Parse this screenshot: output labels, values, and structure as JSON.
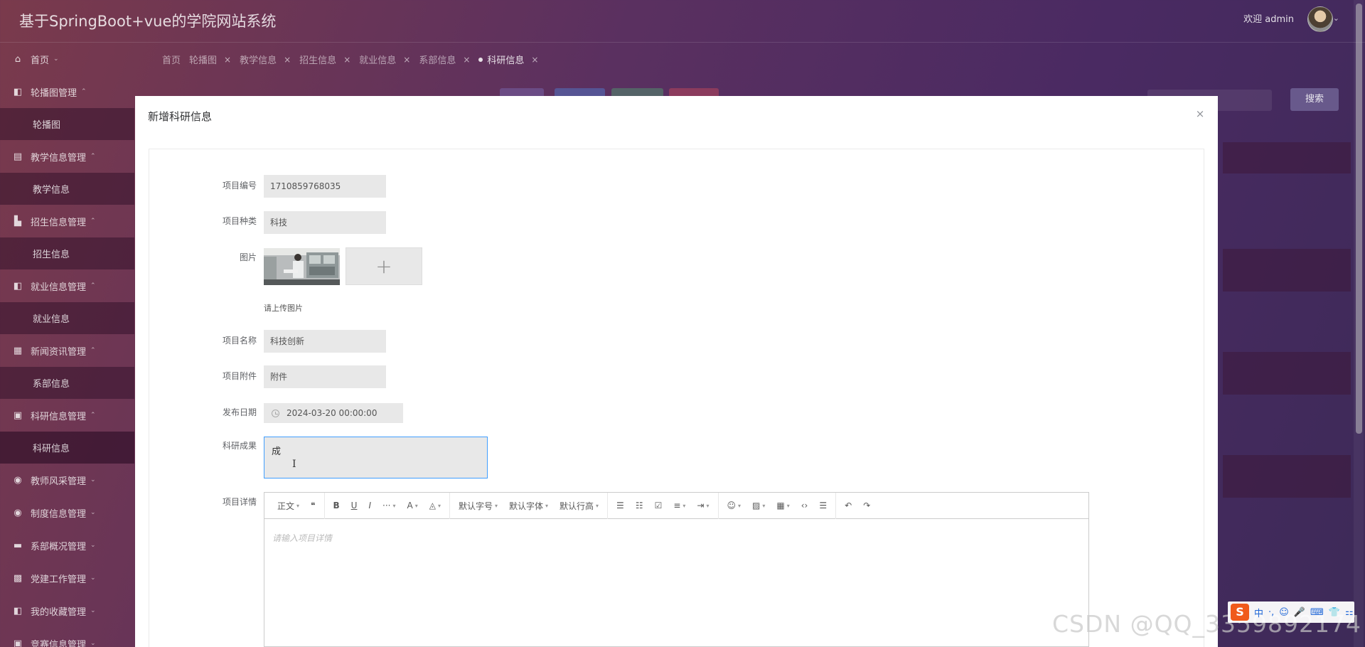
{
  "header": {
    "app_title": "基于SpringBoot+vue的学院网站系统",
    "welcome": "欢迎 admin",
    "avatar_caret": "⌄"
  },
  "sidebar": {
    "items": [
      {
        "label": "首页",
        "icon": "home-icon",
        "glyph": "⌂",
        "caret": "⌄",
        "children": []
      },
      {
        "label": "轮播图管理",
        "icon": "carousel-icon",
        "glyph": "◧",
        "caret": "⌃",
        "children": [
          "轮播图"
        ]
      },
      {
        "label": "教学信息管理",
        "icon": "teaching-icon",
        "glyph": "▤",
        "caret": "⌃",
        "children": [
          "教学信息"
        ]
      },
      {
        "label": "招生信息管理",
        "icon": "admission-icon",
        "glyph": "▙",
        "caret": "⌃",
        "children": [
          "招生信息"
        ]
      },
      {
        "label": "就业信息管理",
        "icon": "employment-icon",
        "glyph": "◧",
        "caret": "⌃",
        "children": [
          "就业信息"
        ]
      },
      {
        "label": "新闻资讯管理",
        "icon": "news-icon",
        "glyph": "▦",
        "caret": "⌃",
        "children": [
          "系部信息"
        ]
      },
      {
        "label": "科研信息管理",
        "icon": "research-icon",
        "glyph": "▣",
        "caret": "⌃",
        "children": [
          "科研信息"
        ]
      },
      {
        "label": "教师风采管理",
        "icon": "teacher-icon",
        "glyph": "◉",
        "caret": "⌄",
        "children": []
      },
      {
        "label": "制度信息管理",
        "icon": "policy-icon",
        "glyph": "◉",
        "caret": "⌄",
        "children": []
      },
      {
        "label": "系部概况管理",
        "icon": "department-icon",
        "glyph": "▬",
        "caret": "⌄",
        "children": []
      },
      {
        "label": "党建工作管理",
        "icon": "party-icon",
        "glyph": "▩",
        "caret": "⌄",
        "children": []
      },
      {
        "label": "我的收藏管理",
        "icon": "favorite-icon",
        "glyph": "◧",
        "caret": "⌄",
        "children": []
      },
      {
        "label": "竞赛信息管理",
        "icon": "competition-icon",
        "glyph": "▣",
        "caret": "⌄",
        "children": []
      }
    ]
  },
  "tabs": [
    {
      "label": "首页",
      "closable": false
    },
    {
      "label": "轮播图",
      "closable": true
    },
    {
      "label": "教学信息",
      "closable": true
    },
    {
      "label": "招生信息",
      "closable": true
    },
    {
      "label": "就业信息",
      "closable": true
    },
    {
      "label": "系部信息",
      "closable": true
    },
    {
      "label": "科研信息",
      "closable": true,
      "active": true
    }
  ],
  "background_toolbar": {
    "search_button": "搜索"
  },
  "dialog": {
    "title": "新增科研信息",
    "close_glyph": "×",
    "fields": {
      "project_no": {
        "label": "项目编号",
        "value": "1710859768035"
      },
      "project_type": {
        "label": "项目种类",
        "value": "科技"
      },
      "image": {
        "label": "图片",
        "upload_tip": "请上传图片",
        "plus_glyph": "+"
      },
      "project_name": {
        "label": "项目名称",
        "value": "科技创新"
      },
      "attachment": {
        "label": "项目附件",
        "value": "附件"
      },
      "publish_date": {
        "label": "发布日期",
        "value": "2024-03-20 00:00:00"
      },
      "achievement": {
        "label": "科研成果",
        "value": "成",
        "cursor_glyph": "I"
      },
      "details": {
        "label": "项目详情",
        "placeholder": "请输入项目详情"
      }
    },
    "editor_toolbar": [
      {
        "label": "正文",
        "icon": "heading-select-icon",
        "caret": true
      },
      {
        "label": "❝",
        "icon": "blockquote-icon",
        "caret": false
      },
      {
        "sep": true
      },
      {
        "label": "B",
        "icon": "bold-icon",
        "caret": false
      },
      {
        "label": "U",
        "icon": "underline-icon",
        "caret": false
      },
      {
        "label": "I",
        "icon": "italic-icon",
        "caret": false
      },
      {
        "label": "···",
        "icon": "more-format-icon",
        "caret": true
      },
      {
        "label": "A",
        "icon": "font-color-icon",
        "caret": true
      },
      {
        "label": "◬",
        "icon": "bg-color-icon",
        "caret": true
      },
      {
        "sep": true
      },
      {
        "label": "默认字号",
        "icon": "font-size-select-icon",
        "caret": true
      },
      {
        "label": "默认字体",
        "icon": "font-family-select-icon",
        "caret": true
      },
      {
        "label": "默认行高",
        "icon": "line-height-select-icon",
        "caret": true
      },
      {
        "sep": true
      },
      {
        "label": "☰",
        "icon": "bullet-list-icon",
        "caret": false
      },
      {
        "label": "☷",
        "icon": "numbered-list-icon",
        "caret": false
      },
      {
        "label": "☑",
        "icon": "todo-icon",
        "caret": false
      },
      {
        "label": "≡",
        "icon": "align-icon",
        "caret": true
      },
      {
        "label": "⇥",
        "icon": "indent-icon",
        "caret": true
      },
      {
        "sep": true
      },
      {
        "label": "☺",
        "icon": "emoji-icon",
        "caret": true
      },
      {
        "label": "▨",
        "icon": "image-insert-icon",
        "caret": true
      },
      {
        "label": "▦",
        "icon": "table-insert-icon",
        "caret": true
      },
      {
        "label": "‹›",
        "icon": "code-icon",
        "caret": false
      },
      {
        "label": "☰",
        "icon": "divider-icon",
        "caret": false
      },
      {
        "sep": true
      },
      {
        "label": "↶",
        "icon": "undo-icon",
        "caret": false
      },
      {
        "label": "↷",
        "icon": "redo-icon",
        "caret": false
      }
    ]
  },
  "watermark": "CSDN @QQ_3359892174",
  "ime": {
    "logo": "S",
    "items": [
      "中",
      "·,",
      "☺",
      "🎤",
      "⌨",
      "👕",
      "⚏"
    ]
  },
  "colors": {
    "accent": "#409eff",
    "input_bg": "#e8e8e8",
    "ime_logo": "#f05a1b"
  }
}
